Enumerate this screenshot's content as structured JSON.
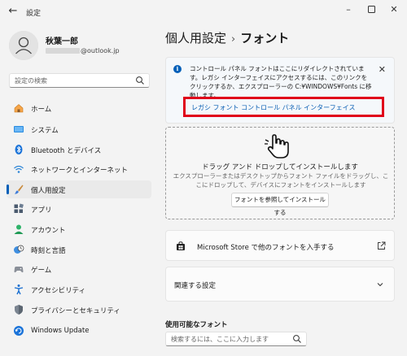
{
  "window": {
    "title": "設定",
    "back_icon": "back-arrow-icon",
    "controls": [
      "minimize-icon",
      "maximize-icon",
      "close-icon"
    ]
  },
  "user": {
    "name": "秋葉一郎",
    "email_suffix": "@outlook.jp"
  },
  "sidebar": {
    "search_placeholder": "設定の検索",
    "items": [
      {
        "label": "ホーム",
        "icon": "home-icon"
      },
      {
        "label": "システム",
        "icon": "system-icon"
      },
      {
        "label": "Bluetooth とデバイス",
        "icon": "bluetooth-icon"
      },
      {
        "label": "ネットワークとインターネット",
        "icon": "wifi-icon"
      },
      {
        "label": "個人用設定",
        "icon": "brush-icon",
        "selected": true
      },
      {
        "label": "アプリ",
        "icon": "apps-icon"
      },
      {
        "label": "アカウント",
        "icon": "account-icon"
      },
      {
        "label": "時刻と言語",
        "icon": "clock-globe-icon"
      },
      {
        "label": "ゲーム",
        "icon": "gamepad-icon"
      },
      {
        "label": "アクセシビリティ",
        "icon": "accessibility-icon"
      },
      {
        "label": "プライバシーとセキュリティ",
        "icon": "shield-icon"
      },
      {
        "label": "Windows Update",
        "icon": "update-icon"
      }
    ]
  },
  "main": {
    "breadcrumb_parent": "個人用設定",
    "breadcrumb_separator": "›",
    "breadcrumb_current": "フォント",
    "info": {
      "text": "コントロール パネル フォントはここにリダイレクトされています。レガシ インターフェイスにアクセスするには、このリンクをクリックするか、エクスプローラーの C:¥WINDOWS¥Fonts に移動します。",
      "link": "レガシ フォント コントロール パネル インターフェイス"
    },
    "drop": {
      "title": "ドラッグ アンド ドロップしてインストールします",
      "subtitle": "エクスプローラーまたはデスクトップからフォント ファイルをドラッグし、ここにドロップして、デバイスにフォントをインストールします",
      "button": "フォントを参照してインストールする"
    },
    "store_link": "Microsoft Store で他のフォントを入手する",
    "related_settings": "関連する設定",
    "available_fonts_heading": "使用可能なフォント",
    "font_search_placeholder": "検索するには、ここに入力します"
  },
  "colors": {
    "accent": "#005fb8",
    "highlight_border": "#e0001a",
    "link": "#0a5fb4"
  }
}
